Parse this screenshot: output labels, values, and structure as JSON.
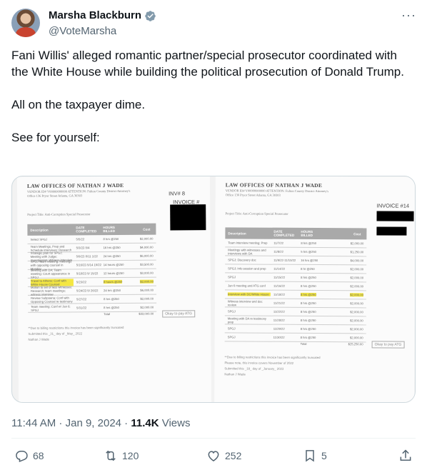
{
  "author": {
    "display_name": "Marsha Blackburn",
    "handle": "@VoteMarsha",
    "verified": true,
    "verified_icon": "verified-badge-icon",
    "verified_color": "#829aab"
  },
  "menu": {
    "more_label": "···"
  },
  "tweet": {
    "paragraphs": [
      "Fani Willis' alleged romantic partner/special prosecutor coordinated with the White House while building the political prosecution of Donald Trump.",
      "All on the taxpayer dime.",
      "See for yourself:"
    ]
  },
  "media": {
    "left_doc": {
      "firm": "LAW OFFICES OF NATHAN J WADE",
      "meta": "VENDOR ID# V00000000000 ATTENTION: Fulton County District Attorney's Office 136 Pryor Street Atlanta, GA 30303",
      "project": "Project Title: Anti-Corruption Special Prosecutor",
      "invoice_mark": "INV# 8",
      "invoice_label": "INVOICE #",
      "table_headers": [
        "Description",
        "DATE COMPLETED",
        "HOURS BILLED",
        "Cost"
      ],
      "rows": [
        [
          "Select SPGJ",
          "5/5/22",
          "8 hrs @250",
          "$2,000.00"
        ],
        [
          "Team Meetings, Prep and Schedule interviews; Research",
          "5/3/22-5/4",
          "16 hrs @250",
          "$4,000.00"
        ],
        [
          "Strategic plan for SPGJ; Meeting with Judge; Investigation; Witness interview",
          "5/9/22-5/11 1/22",
          "24 hrs @250",
          "$6,000.00"
        ],
        [
          "SPGJ Team Meeting; Meetings with opposing counsel in Monday",
          "5/16/22-5/14 15/22",
          "14 hours @250",
          "$3,500.00"
        ],
        [
          "Meeting with DA; Team meeting; Court appearance in SPGJ",
          "5/18/22-5/ 15/22",
          "12 hours @250",
          "$3,000.00"
        ],
        [
          "Travel to Athens; Conf with White House Counsel",
          "5/23/22",
          "8 hours @250",
          "$2,000.00"
        ],
        [
          "Motion to set of less witnesses; Research; team meetings; witness interview",
          "5/24/22-5/ 26/22",
          "24 hrs @250",
          "$6,000.00"
        ],
        [
          "Review Subpoena; Conf with Opposing Counsel re testimony",
          "5/27/22",
          "8 hrs @250",
          "$2,000.00"
        ],
        [
          "Team meeting; Conf w/ Jan 6; SPGJ",
          "5/31/22",
          "8 hrs @250",
          "$2,000.00"
        ]
      ],
      "highlight_row": 5,
      "total_label": "Total",
      "total_value": "$33,000.00",
      "okay_box": "Okay to pay ATG",
      "notes": [
        "**Due to billing restrictions this invoice has been significantly truncated",
        "Submitted this _31_ day of _May_ 2022",
        "Nathan J Wade"
      ]
    },
    "right_doc": {
      "firm": "LAW OFFICES OF NATHAN J WADE",
      "meta": "VENDOR ID# V00000000000 ATTENTION: Fulton County District Attorney's Office 136 Pryor Street Atlanta, GA 30303",
      "project": "Project Title: Anti-Corruption Special Prosecutor",
      "invoice_label": "INVOICE #14",
      "table_headers": [
        "Description",
        "DATE COMPLETED",
        "HOURS BILLED",
        "Cost"
      ],
      "rows": [
        [
          "Team interview meeting; Prep",
          "11/7/22",
          "8 hrs @250",
          "$2,000.00"
        ],
        [
          "Meetings with witnesses and interviews with DA",
          "11/8/22",
          "5 hrs @250",
          "$1,250.00"
        ],
        [
          "SPGJ; Discovery doc",
          "11/9/22-11/10/22",
          "16 hrs @250",
          "$4,000.00"
        ],
        [
          "SPGJ; Info session and prep",
          "11/14/22",
          "8 hr @250",
          "$2,000.00"
        ],
        [
          "SPGJ",
          "11/15/22",
          "8 hrs @250",
          "$2,000.00"
        ],
        [
          "Jan 6 meeting and ATG conf",
          "11/16/22",
          "8 hrs @250",
          "$2,000.00"
        ],
        [
          "Interview with DC/White House",
          "11/18/22",
          "8 hrs @250",
          "$2,000.00"
        ],
        [
          "Witness interview and doc review",
          "11/21/22",
          "8 hrs @250",
          "$2,000.00"
        ],
        [
          "SPGJ",
          "11/22/22",
          "8 hrs @250",
          "$2,000.00"
        ],
        [
          "Meeting with DA re testimony prep",
          "11/28/22",
          "8 hrs @250",
          "$2,000.00"
        ],
        [
          "SPGJ",
          "11/29/22",
          "8 hrs @250",
          "$2,000.00"
        ],
        [
          "SPGJ",
          "11/30/22",
          "8 hrs @250",
          "$2,000.00"
        ]
      ],
      "highlight_row": 6,
      "total_label": "Total",
      "total_value": "$25,250.00",
      "okay_box": "Okay to pay ATG",
      "notes": [
        "**Due to billing restrictions this invoice has been significantly truncated",
        "Please note, this invoice covers November of 2022",
        "Submitted this _18_ day of _January_ 2023",
        "Nathan J Wade"
      ]
    }
  },
  "meta": {
    "time": "11:44 AM",
    "separator": " · ",
    "date": "Jan 9, 2024",
    "views_count": "11.4K",
    "views_label": " Views"
  },
  "actions": {
    "replies": "68",
    "retweets": "120",
    "likes": "252",
    "bookmarks": "5"
  }
}
